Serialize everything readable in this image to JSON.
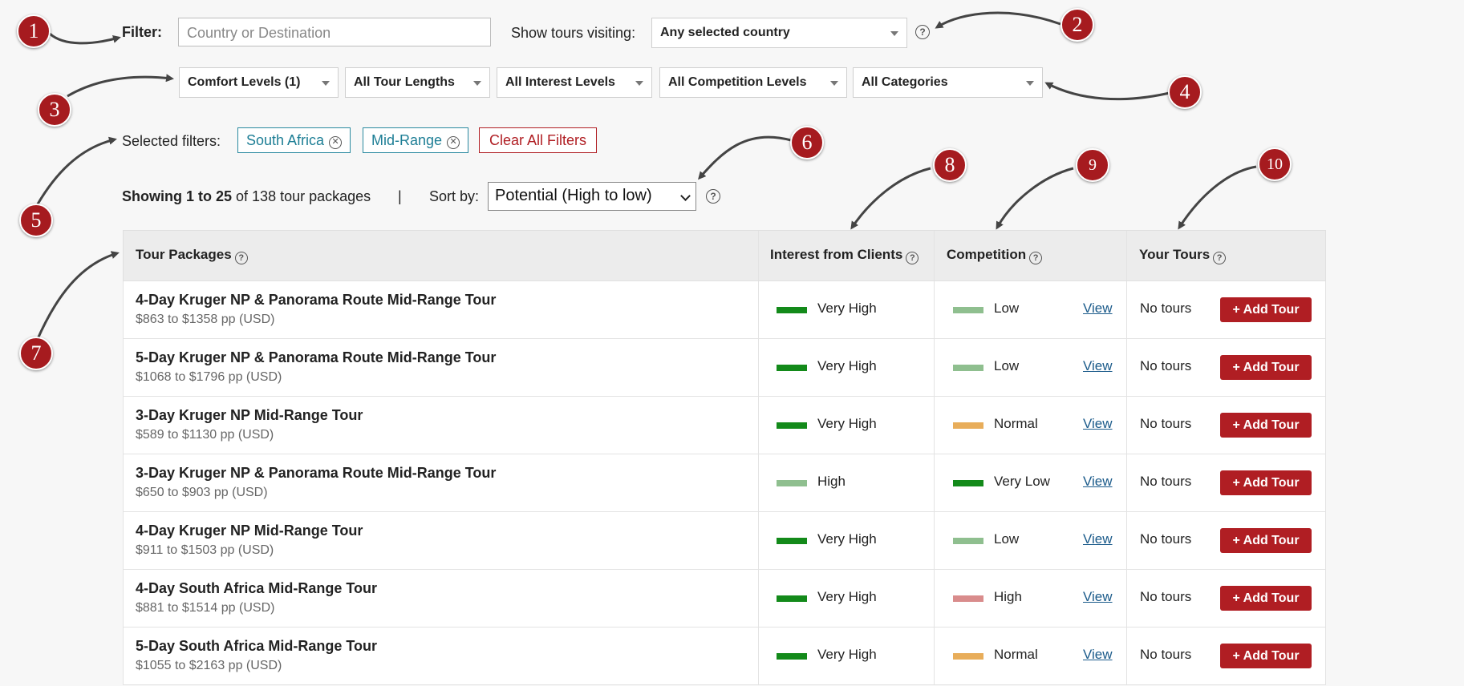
{
  "filter": {
    "label": "Filter:",
    "placeholder": "Country or Destination"
  },
  "visiting": {
    "label": "Show tours visiting:",
    "value": "Any selected country"
  },
  "dropdowns": [
    "Comfort Levels (1)",
    "All Tour Lengths",
    "All Interest Levels",
    "All Competition Levels",
    "All Categories"
  ],
  "selected": {
    "label": "Selected filters:",
    "chips": [
      "South Africa",
      "Mid-Range"
    ],
    "clear": "Clear All Filters"
  },
  "summary": {
    "showing": "Showing 1 to 25",
    "of_text": "of 138 tour packages",
    "sep": "|",
    "sort_label": "Sort by:",
    "sort_value": "Potential (High to low)"
  },
  "table": {
    "headers": {
      "packages": "Tour Packages",
      "interest": "Interest from Clients",
      "competition": "Competition",
      "yours": "Your Tours"
    },
    "view_label": "View",
    "no_tours": "No tours",
    "add_label": "+ Add Tour",
    "rows": [
      {
        "name": "4-Day Kruger NP & Panorama Route Mid-Range Tour",
        "price": "$863 to $1358 pp (USD)",
        "interest": "Very High",
        "competition": "Low"
      },
      {
        "name": "5-Day Kruger NP & Panorama Route Mid-Range Tour",
        "price": "$1068 to $1796 pp (USD)",
        "interest": "Very High",
        "competition": "Low"
      },
      {
        "name": "3-Day Kruger NP Mid-Range Tour",
        "price": "$589 to $1130 pp (USD)",
        "interest": "Very High",
        "competition": "Normal"
      },
      {
        "name": "3-Day Kruger NP & Panorama Route Mid-Range Tour",
        "price": "$650 to $903 pp (USD)",
        "interest": "High",
        "competition": "Very Low"
      },
      {
        "name": "4-Day Kruger NP Mid-Range Tour",
        "price": "$911 to $1503 pp (USD)",
        "interest": "Very High",
        "competition": "Low"
      },
      {
        "name": "4-Day South Africa Mid-Range Tour",
        "price": "$881 to $1514 pp (USD)",
        "interest": "Very High",
        "competition": "High"
      },
      {
        "name": "5-Day South Africa Mid-Range Tour",
        "price": "$1055 to $2163 pp (USD)",
        "interest": "Very High",
        "competition": "Normal"
      }
    ]
  },
  "level_colors": {
    "Very High": "#138a1a",
    "High": "#8fbf8f",
    "Very Low": "#138a1a",
    "Low": "#8fbf8f",
    "Normal": "#e8ad5a",
    "Competition High": "#d98c8c"
  },
  "markers": [
    "1",
    "2",
    "3",
    "4",
    "5",
    "6",
    "7",
    "8",
    "9",
    "10"
  ],
  "colors": {
    "accent": "#b01e23",
    "chip": "#1d7e95",
    "marker": "#a61b1f"
  }
}
